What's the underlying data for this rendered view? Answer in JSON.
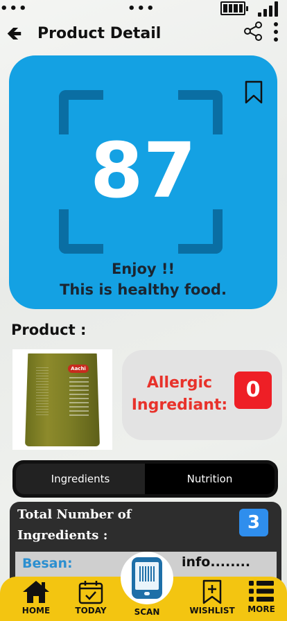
{
  "header": {
    "title": "Product  Detail",
    "back_icon": "arrow-left-icon"
  },
  "score_card": {
    "score": "87",
    "message_line1": "Enjoy !!",
    "message_line2": "This is healthy food.",
    "background": "#14a1e3"
  },
  "product": {
    "label": "Product :",
    "image_brand": "Aachi"
  },
  "allergic": {
    "label": "Allergic Ingrediant:",
    "count": "0",
    "count_color": "#ee1f26"
  },
  "tabs": [
    {
      "label": "Ingredients",
      "active": true
    },
    {
      "label": "Nutrition",
      "active": false
    }
  ],
  "ingredients": {
    "total_label": "Total Number of Ingredients  :",
    "total_count": "3",
    "items": [
      {
        "name": "Besan:",
        "info": "info........"
      }
    ]
  },
  "bottom_nav": {
    "items": [
      {
        "label": "HOME",
        "icon": "home-icon"
      },
      {
        "label": "TODAY",
        "icon": "calendar-check-icon"
      },
      {
        "label": "SCAN",
        "icon": "phone-barcode-icon"
      },
      {
        "label": "WISHLIST",
        "icon": "bookmark-plus-icon"
      },
      {
        "label": "MORE",
        "icon": "list-icon"
      }
    ],
    "background": "#f3c511"
  }
}
